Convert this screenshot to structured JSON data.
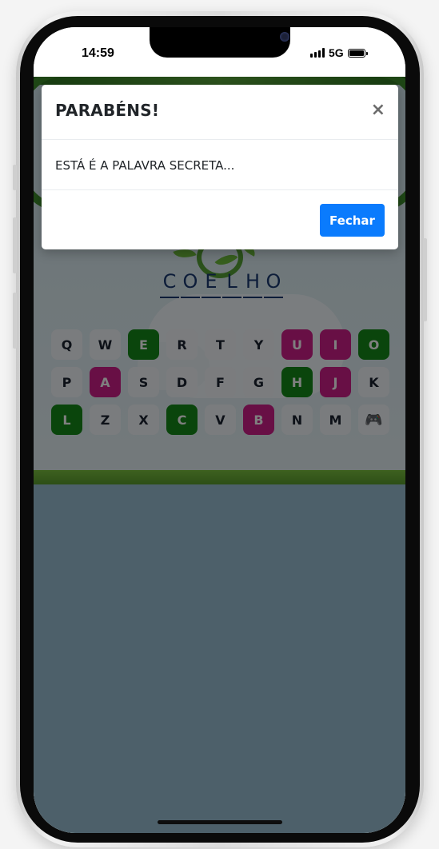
{
  "status_bar": {
    "time": "14:59",
    "network": "5G",
    "signal_bars": 4,
    "battery_level": 1.0
  },
  "game": {
    "secret_word": [
      "C",
      "O",
      "E",
      "L",
      "H",
      "O"
    ],
    "keyboard": [
      [
        {
          "letter": "Q",
          "state": "default"
        },
        {
          "letter": "W",
          "state": "default"
        },
        {
          "letter": "E",
          "state": "correct"
        },
        {
          "letter": "R",
          "state": "default"
        },
        {
          "letter": "T",
          "state": "default"
        },
        {
          "letter": "Y",
          "state": "default"
        },
        {
          "letter": "U",
          "state": "wrong"
        },
        {
          "letter": "I",
          "state": "wrong"
        },
        {
          "letter": "O",
          "state": "correct"
        }
      ],
      [
        {
          "letter": "P",
          "state": "default"
        },
        {
          "letter": "A",
          "state": "wrong"
        },
        {
          "letter": "S",
          "state": "default"
        },
        {
          "letter": "D",
          "state": "default"
        },
        {
          "letter": "F",
          "state": "default"
        },
        {
          "letter": "G",
          "state": "default"
        },
        {
          "letter": "H",
          "state": "correct"
        },
        {
          "letter": "J",
          "state": "wrong"
        },
        {
          "letter": "K",
          "state": "default"
        }
      ],
      [
        {
          "letter": "L",
          "state": "correct"
        },
        {
          "letter": "Z",
          "state": "default"
        },
        {
          "letter": "X",
          "state": "default"
        },
        {
          "letter": "C",
          "state": "correct"
        },
        {
          "letter": "V",
          "state": "default"
        },
        {
          "letter": "B",
          "state": "wrong"
        },
        {
          "letter": "N",
          "state": "default"
        },
        {
          "letter": "M",
          "state": "default"
        },
        {
          "letter": "🎮",
          "state": "icon",
          "icon": "gamepad-icon"
        }
      ]
    ],
    "colors": {
      "correct": "#148a18",
      "wrong": "#d01e8a",
      "word": "#1b3b73"
    }
  },
  "modal": {
    "title": "PARABÉNS!",
    "close_symbol": "×",
    "message": "ESTÁ É A PALAVRA SECRETA...",
    "button_label": "Fechar",
    "button_color": "#0a7bfd"
  }
}
